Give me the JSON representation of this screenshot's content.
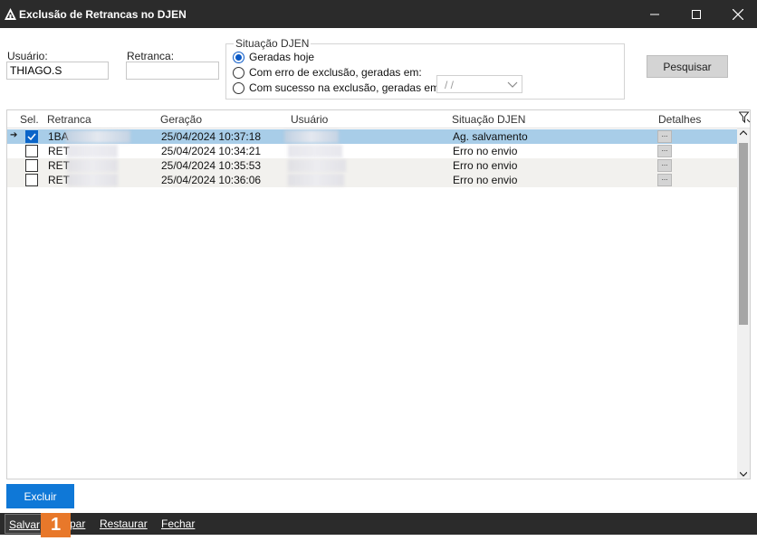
{
  "window": {
    "title": "Exclusão de Retrancas no DJEN",
    "minimize_glyph": "—",
    "maximize_glyph": "☐",
    "close_glyph": "✕"
  },
  "filters": {
    "usuario_label": "Usuário:",
    "usuario_value": "THIAGO.S",
    "retranca_label": "Retranca:",
    "retranca_value": "",
    "situacao_legend": "Situação DJEN",
    "radio_options": [
      {
        "label": "Geradas hoje",
        "checked": true
      },
      {
        "label": "Com erro de exclusão, geradas em:",
        "checked": false
      },
      {
        "label": "Com sucesso na exclusão, geradas em:",
        "checked": false
      }
    ],
    "date_value": "/ /",
    "search_button": "Pesquisar"
  },
  "grid": {
    "columns": [
      "Sel.",
      "Retranca",
      "Geração",
      "Usuário",
      "Situação DJEN",
      "Detalhes"
    ],
    "rows": [
      {
        "checked": true,
        "retranca": "1BA",
        "geracao": "25/04/2024 10:37:18",
        "situacao": "Ag. salvamento",
        "detalhes": "..."
      },
      {
        "checked": false,
        "retranca": "RET",
        "geracao": "25/04/2024 10:34:21",
        "situacao": "Erro no envio",
        "detalhes": "..."
      },
      {
        "checked": false,
        "retranca": "RET",
        "geracao": "25/04/2024 10:35:53",
        "situacao": "Erro no envio",
        "detalhes": "..."
      },
      {
        "checked": false,
        "retranca": "RET",
        "geracao": "25/04/2024 10:36:06",
        "situacao": "Erro no envio",
        "detalhes": "..."
      }
    ],
    "selected_row_pointer": "➔"
  },
  "actions": {
    "excluir": "Excluir"
  },
  "bottom_bar": {
    "salvar": "Salvar",
    "limpar_partial": "par",
    "restaurar": "Restaurar",
    "fechar": "Fechar",
    "badge": "1"
  },
  "colors": {
    "titlebar": "#2b2b2b",
    "accent_blue": "#0f78d7",
    "selected_row": "#a8cde8",
    "badge_orange": "#e8782a"
  }
}
